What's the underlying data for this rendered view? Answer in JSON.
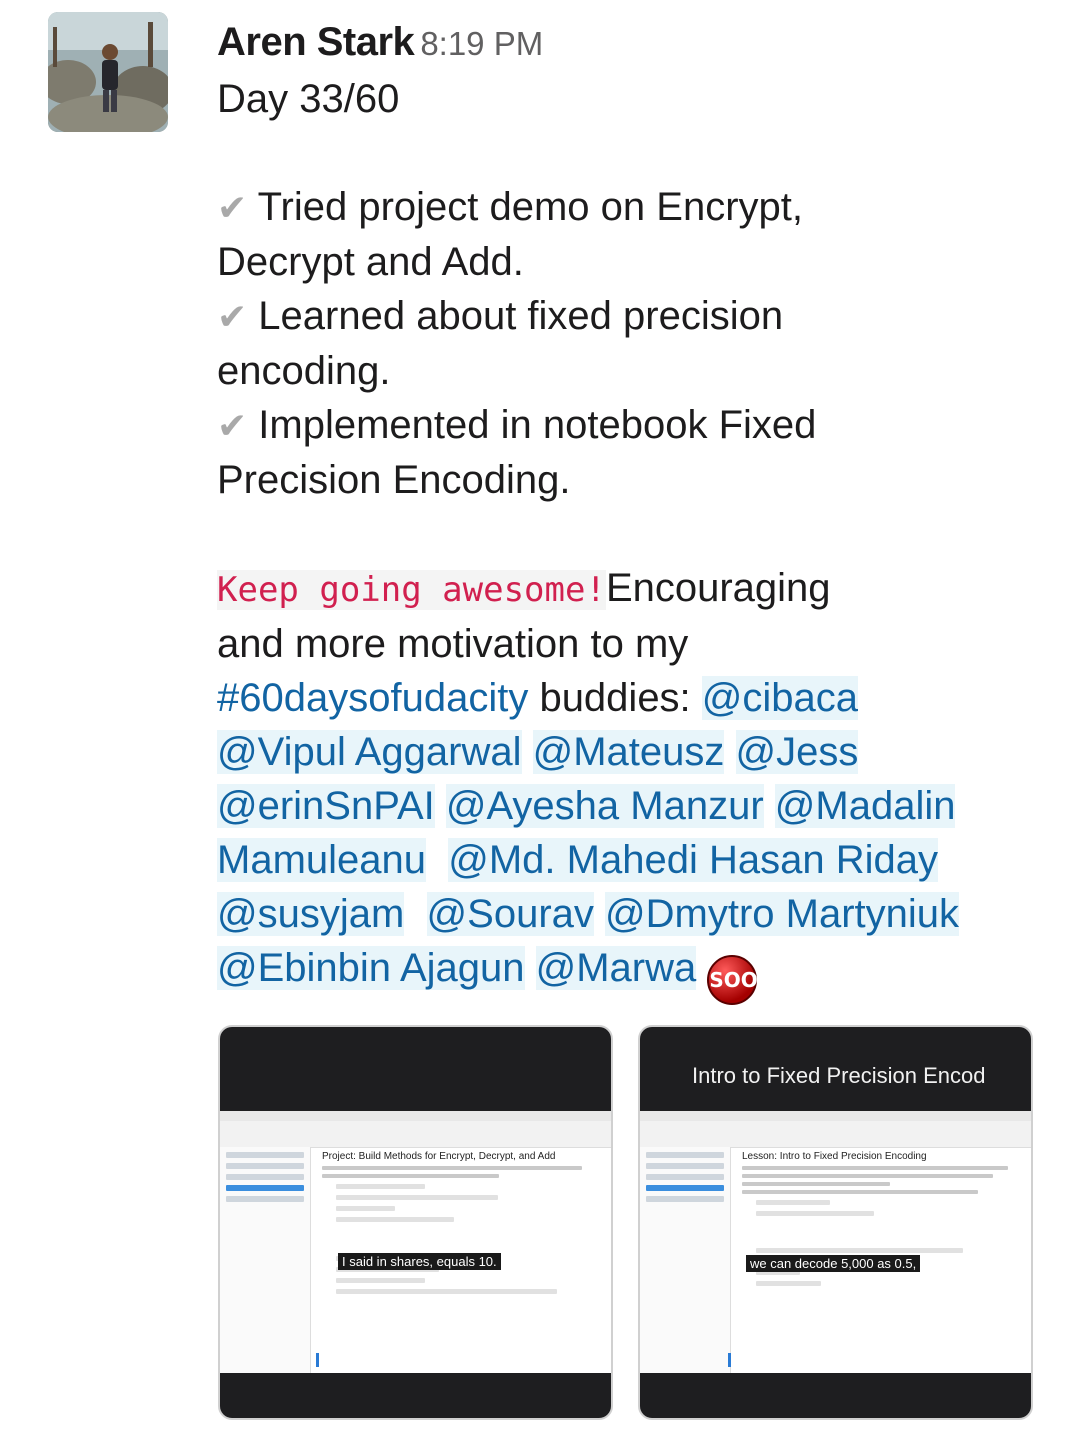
{
  "author": "Aren Stark",
  "timestamp": "8:19 PM",
  "lines": {
    "day": "Day 33/60",
    "check_symbol": "✔",
    "item1a": "Tried project demo on Encrypt,",
    "item1b": "Decrypt and Add.",
    "item2a": "Learned about fixed precision",
    "item2b": "encoding.",
    "item3a": "Implemented in notebook Fixed",
    "item3b": "Precision Encoding.",
    "code": "Keep going awesome!",
    "enc": "Encouraging",
    "motiv": "and more motivation to my",
    "hashtag": "#60daysofudacity",
    "buddies": " buddies: "
  },
  "mentions": {
    "m1": "@cibaca",
    "m2": "@Vipul Aggarwal",
    "m3": "@Mateusz",
    "m4": "@Jess",
    "m5": "@erinSnPAI",
    "m6": "@Ayesha Manzur",
    "m7a": "@Madalin",
    "m7b": "Mamuleanu",
    "m8": "@Md. Mahedi Hasan Riday",
    "m9": "@susyjam",
    "m10": "@Sourav",
    "m11": "@Dmytro Martyniuk",
    "m12": "@Ebinbin Ajagun",
    "m13": "@Marwa"
  },
  "emoji": {
    "name": "soon-emoji",
    "text": "SOON"
  },
  "attachments": [
    {
      "notebook_title": "Project: Build Methods for Encrypt, Decrypt, and Add",
      "caption": "I said in shares, equals 10."
    },
    {
      "video_title": "Intro to Fixed Precision Encod",
      "notebook_title": "Lesson: Intro to Fixed Precision Encoding",
      "caption": "we can decode 5,000 as 0.5,"
    }
  ],
  "colors": {
    "link": "#1264a3",
    "mention_bg": "#e8f5fa",
    "code": "#d1204f",
    "time": "#616061"
  }
}
